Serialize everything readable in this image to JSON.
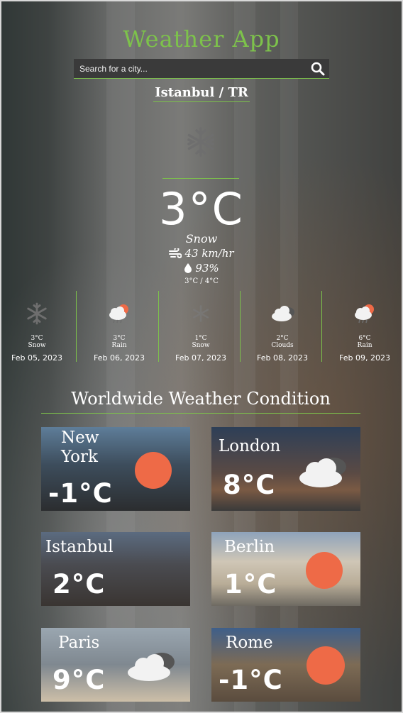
{
  "app": {
    "title": "Weather App"
  },
  "search": {
    "placeholder": "Search for a city..."
  },
  "location": {
    "label": "Istanbul / TR"
  },
  "current": {
    "icon": "snowflake-icon",
    "temperature": "3°C",
    "condition": "Snow",
    "wind": "43 km/hr",
    "humidity": "93%",
    "min_max": "3°C / 4°C"
  },
  "forecast": [
    {
      "temp": "3°C",
      "condition": "Snow",
      "date": "Feb 05, 2023",
      "icon": "snowflake-icon"
    },
    {
      "temp": "3°C",
      "condition": "Rain",
      "date": "Feb 06, 2023",
      "icon": "rain-sun-icon"
    },
    {
      "temp": "1°C",
      "condition": "Snow",
      "date": "Feb 07, 2023",
      "icon": "snowflake-icon"
    },
    {
      "temp": "2°C",
      "condition": "Clouds",
      "date": "Feb 08, 2023",
      "icon": "cloud-icon"
    },
    {
      "temp": "6°C",
      "condition": "Rain",
      "date": "Feb 09, 2023",
      "icon": "rain-sun-icon"
    }
  ],
  "worldwide": {
    "title": "Worldwide Weather Condition",
    "cities": [
      {
        "name": "New York",
        "temp": "-1°C",
        "icon": "sun-icon"
      },
      {
        "name": "London",
        "temp": "8°C",
        "icon": "cloud-icon"
      },
      {
        "name": "Istanbul",
        "temp": "2°C",
        "icon": "none"
      },
      {
        "name": "Berlin",
        "temp": "1°C",
        "icon": "sun-icon"
      },
      {
        "name": "Paris",
        "temp": "9°C",
        "icon": "cloud-icon"
      },
      {
        "name": "Rome",
        "temp": "-1°C",
        "icon": "sun-icon"
      }
    ]
  },
  "colors": {
    "accent": "#7dc24b",
    "sun": "#ee6a47",
    "text": "#ffffff"
  }
}
